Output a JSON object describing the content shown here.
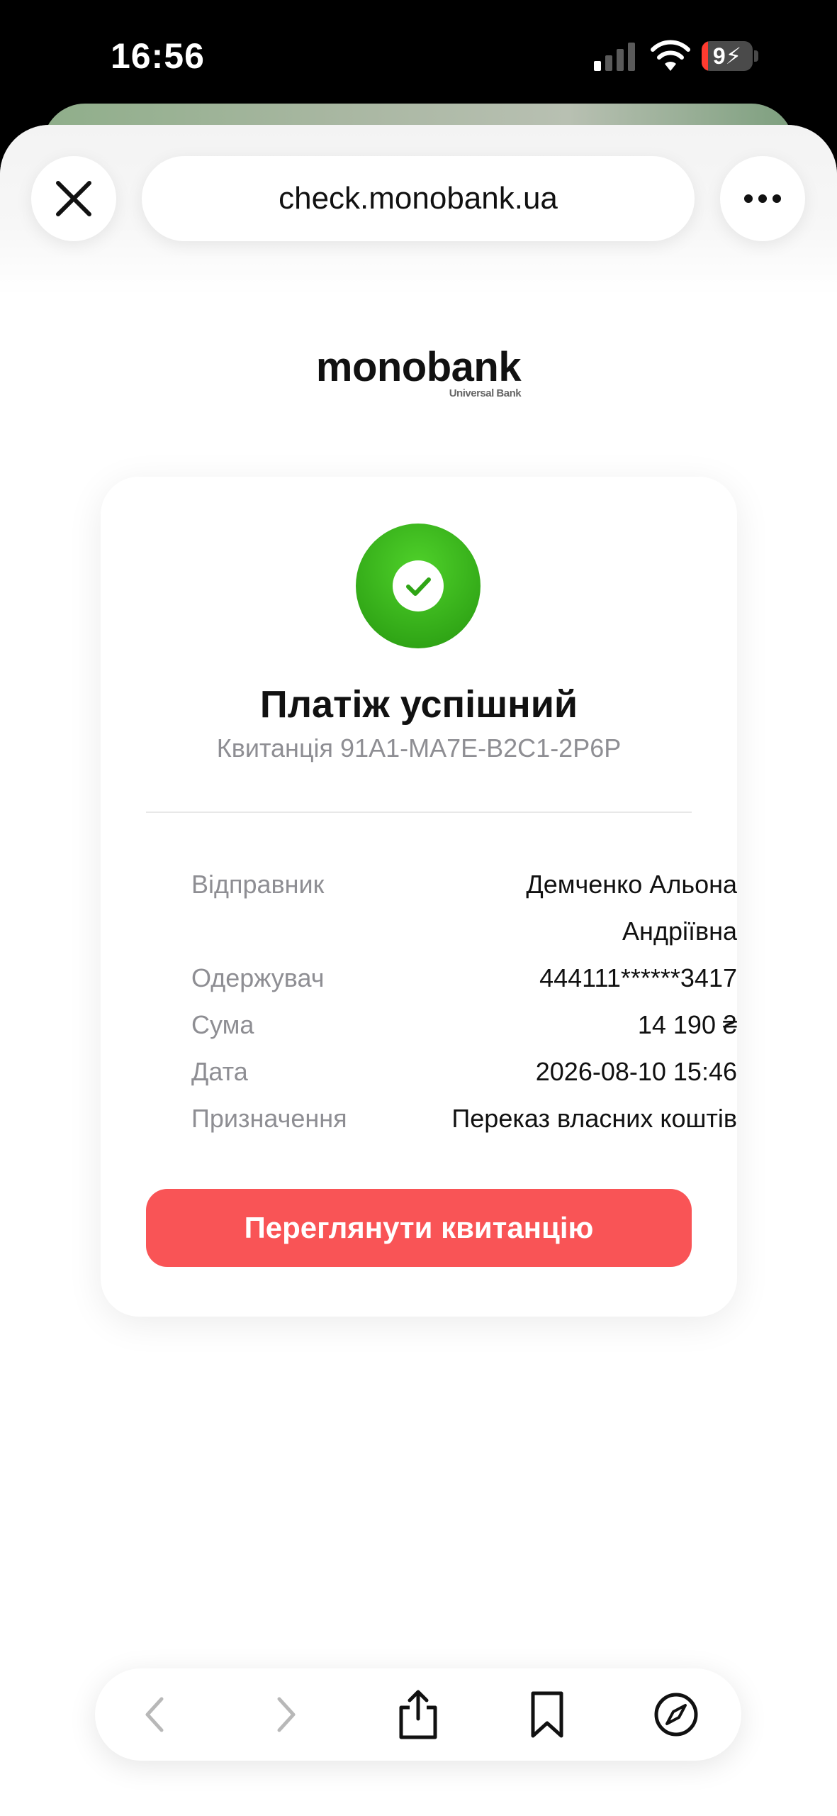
{
  "status": {
    "time": "16:56",
    "battery": "9",
    "battery_level": 0.09
  },
  "browser": {
    "url": "check.monobank.ua"
  },
  "brand": {
    "name": "monobank",
    "tagline": "Universal Bank"
  },
  "receipt": {
    "title": "Платіж успішний",
    "subtitle": "Квитанція 91A1-MA7E-B2C1-2P6P",
    "rows": [
      {
        "label": "Відправник",
        "value_line1": "Демченко Альона",
        "value_line2": "Андріївна"
      },
      {
        "label": "Одержувач",
        "value": "444111******3417"
      },
      {
        "label": "Сума",
        "value": "14 190 ₴"
      },
      {
        "label": "Дата",
        "value": "2026-08-10 15:46"
      },
      {
        "label": "Призначення",
        "value": "Переказ власних коштів"
      }
    ],
    "cta_label": "Переглянути квитанцію"
  },
  "colors": {
    "accent": "#f95456",
    "success": "#37b51a"
  },
  "icons": [
    "close-icon",
    "more-icon",
    "checkmark-icon",
    "back-icon",
    "forward-icon",
    "share-icon",
    "bookmarks-icon",
    "compass-icon"
  ]
}
